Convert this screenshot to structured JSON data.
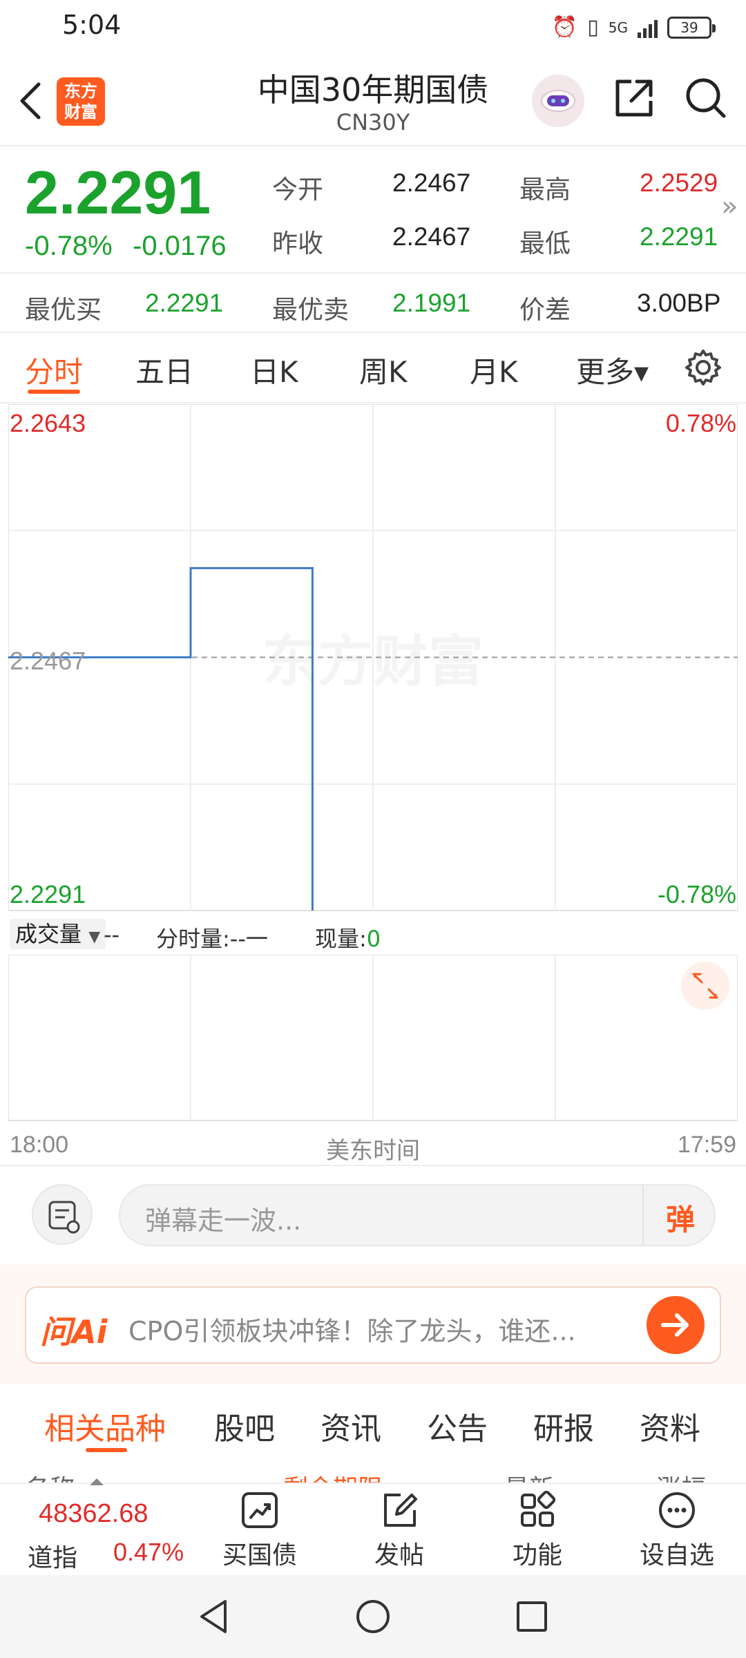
{
  "status_bar": {
    "time": "5:04",
    "battery": "39",
    "network": "5G"
  },
  "header": {
    "back_icon": "chevron-left-icon",
    "logo_line1": "东方",
    "logo_line2": "财富",
    "title": "中国30年期国债",
    "subtitle": "CN30Y"
  },
  "quote": {
    "price": "2.2291",
    "change_pct": "-0.78%",
    "change_abs": "-0.0176",
    "open_label": "今开",
    "open_value": "2.2467",
    "high_label": "最高",
    "high_value": "2.2529",
    "prev_close_label": "昨收",
    "prev_close_value": "2.2467",
    "low_label": "最低",
    "low_value": "2.2291",
    "best_bid_label": "最优买",
    "best_bid_value": "2.2291",
    "best_ask_label": "最优卖",
    "best_ask_value": "2.1991",
    "spread_label": "价差",
    "spread_value": "3.00BP",
    "expand_glyph": "»"
  },
  "tabs": [
    {
      "label": "分时",
      "active": true
    },
    {
      "label": "五日"
    },
    {
      "label": "日K"
    },
    {
      "label": "周K"
    },
    {
      "label": "月K"
    },
    {
      "label": "更多▾"
    }
  ],
  "chart": {
    "top_left": "2.2643",
    "top_right": "0.78%",
    "mid_left": "2.2467",
    "bottom_left": "2.2291",
    "bottom_right": "-0.78%",
    "watermark": "东方财富"
  },
  "chart_data": {
    "type": "line",
    "title": "",
    "xlabel": "美东时间",
    "ylabel": "",
    "x_start_label": "18:00",
    "x_end_label": "17:59",
    "ylim": [
      2.2291,
      2.2643
    ],
    "reference_line": 2.2467,
    "series": [
      {
        "points": [
          [
            0.0,
            2.2467
          ],
          [
            0.25,
            2.2467
          ],
          [
            0.25,
            2.2529
          ],
          [
            0.417,
            2.2529
          ],
          [
            0.417,
            2.2291
          ]
        ]
      }
    ]
  },
  "volume_bar": {
    "dropdown_label": "成交量",
    "dropdown_value": "--",
    "period_label": "分时量:",
    "period_value": "--一",
    "current_label": "现量:",
    "current_value": "0"
  },
  "axis": {
    "start": "18:00",
    "center": "美东时间",
    "end": "17:59"
  },
  "danmu": {
    "placeholder": "弹幕走一波...",
    "send_label": "弹"
  },
  "ai_banner": {
    "brand": "问Ai",
    "text": "CPO引领板块冲锋！除了龙头，谁还..."
  },
  "bottom_tabs": [
    {
      "label": "相关品种",
      "active": true
    },
    {
      "label": "股吧"
    },
    {
      "label": "资讯"
    },
    {
      "label": "公告"
    },
    {
      "label": "研报"
    },
    {
      "label": "资料"
    }
  ],
  "list_header": {
    "col1": "名称",
    "col2": "剩余期限",
    "col3": "最新",
    "col4": "涨幅"
  },
  "bottom_bar": {
    "index_value": "48362.68",
    "index_name": "道指",
    "index_change": "0.47%",
    "buy_bond": "买国债",
    "post": "发帖",
    "features": "功能",
    "add_watch": "设自选"
  }
}
